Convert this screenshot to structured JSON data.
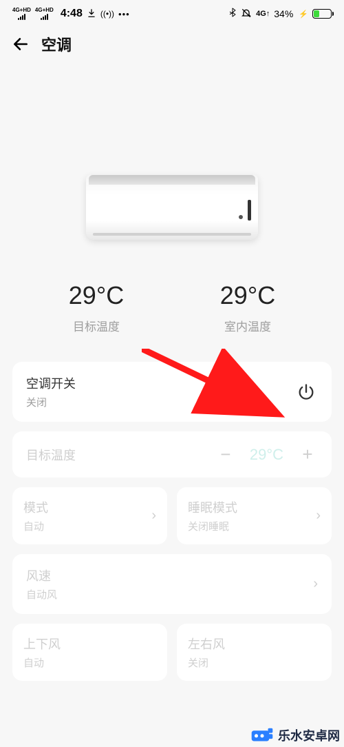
{
  "status": {
    "sig1": "4G+HD",
    "sig2": "4G+HD",
    "time": "4:48",
    "net_label": "4G↑",
    "battery_pct": "34%"
  },
  "header": {
    "title": "空调"
  },
  "temperature": {
    "target_value": "29°C",
    "target_label": "目标温度",
    "room_value": "29°C",
    "room_label": "室内温度"
  },
  "power": {
    "label": "空调开关",
    "status": "关闭"
  },
  "target_temp_card": {
    "label": "目标温度",
    "value": "29°C"
  },
  "grid": {
    "mode": {
      "label": "模式",
      "sub": "自动"
    },
    "sleep": {
      "label": "睡眠模式",
      "sub": "关闭睡眠"
    },
    "fan": {
      "label": "风速",
      "sub": "自动风"
    },
    "updown": {
      "label": "上下风",
      "sub": "自动"
    },
    "leftright": {
      "label": "左右风",
      "sub": "关闭"
    }
  },
  "watermark": "乐水安卓网"
}
